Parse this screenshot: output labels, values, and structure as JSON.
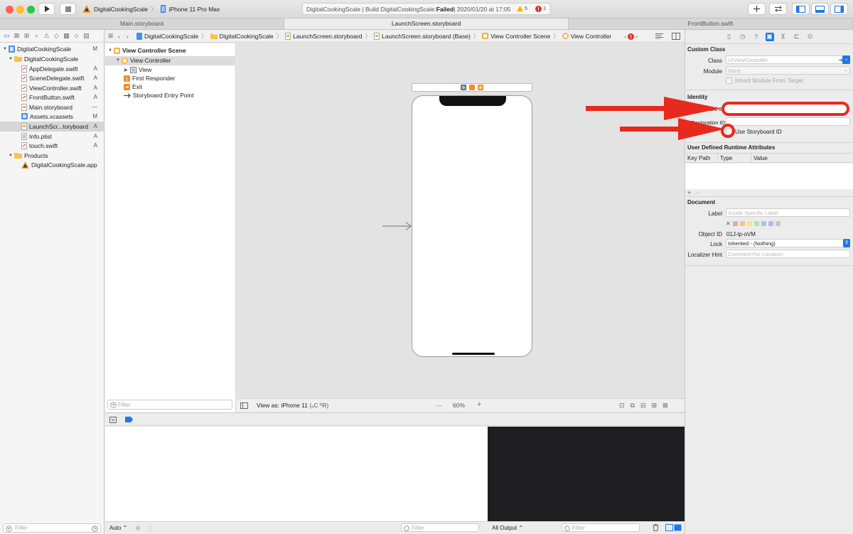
{
  "toolbar": {
    "scheme": "DigitalCookingScale",
    "device": "iPhone 11 Pro Max",
    "activity_prefix": "DigitalCookingScale | Build DigitalCookingScale: ",
    "activity_status": "Failed",
    "activity_time": " | 2020/01/20 at 17:05",
    "warning_count": "5",
    "error_count": "1"
  },
  "tabs": [
    "Main.storyboard",
    "LaunchScreen.storyboard",
    "FrontButton.swift"
  ],
  "navigator": {
    "items": [
      {
        "label": "DigitalCookingScale",
        "badge": "M",
        "kind": "project"
      },
      {
        "label": "DigitalCookingScale",
        "badge": "",
        "kind": "folder"
      },
      {
        "label": "AppDelegate.swift",
        "badge": "A",
        "kind": "swift"
      },
      {
        "label": "SceneDelegate.swift",
        "badge": "A",
        "kind": "swift"
      },
      {
        "label": "ViewController.swift",
        "badge": "A",
        "kind": "swift"
      },
      {
        "label": "FrontButton.swift",
        "badge": "A",
        "kind": "swift"
      },
      {
        "label": "Main.storyboard",
        "badge": "—",
        "kind": "storyboard"
      },
      {
        "label": "Assets.xcassets",
        "badge": "M",
        "kind": "assets"
      },
      {
        "label": "LaunchScr...toryboard",
        "badge": "A",
        "kind": "storyboard"
      },
      {
        "label": "Info.plist",
        "badge": "A",
        "kind": "plist"
      },
      {
        "label": "touch.swift",
        "badge": "A",
        "kind": "swift"
      },
      {
        "label": "Products",
        "badge": "",
        "kind": "folder"
      },
      {
        "label": "DigitalCookingScale.app",
        "badge": "",
        "kind": "app"
      }
    ],
    "filter_placeholder": "Filter"
  },
  "jumpbar": {
    "crumbs": [
      "DigitalCookingScale",
      "DigitalCookingScale",
      "LaunchScreen.storyboard",
      "LaunchScreen.storyboard (Base)",
      "View Controller Scene",
      "View Controller"
    ]
  },
  "outline": {
    "scene": "View Controller Scene",
    "items": [
      "View Controller",
      "View",
      "First Responder",
      "Exit",
      "Storyboard Entry Point"
    ],
    "filter_placeholder": "Filter"
  },
  "canvas": {
    "view_as_prefix": "View as: ",
    "view_as_device": "iPhone 11",
    "view_as_suffix": " (ᵤC ʰR)",
    "zoom": "60%",
    "zoom_out": "—",
    "zoom_in": "+"
  },
  "debug": {
    "auto_label": "Auto ⌃",
    "filter_placeholder": "Filter",
    "output_label": "All Output ⌃"
  },
  "inspector": {
    "custom_class": {
      "title": "Custom Class",
      "class_label": "Class",
      "class_placeholder": "UIViewController",
      "module_label": "Module",
      "module_placeholder": "None",
      "inherit_label": "Inherit Module From Target"
    },
    "identity": {
      "title": "Identity",
      "storyboard_id_label": "Storyboard ID",
      "restoration_id_label": "Restoration ID",
      "use_storyboard_id_label": "Use Storyboard ID"
    },
    "runtime": {
      "title": "User Defined Runtime Attributes",
      "columns": [
        "Key Path",
        "Type",
        "Value"
      ]
    },
    "document": {
      "title": "Document",
      "label_label": "Label",
      "label_placeholder": "Xcode Specific Label",
      "object_id_label": "Object ID",
      "object_id": "01J-lp-oVM",
      "lock_label": "Lock",
      "lock_value": "Inherited - (Nothing)",
      "localizer_label": "Localizer Hint",
      "localizer_placeholder": "Comment For Localizer",
      "swatch_colors": [
        "#f3a3a3",
        "#f6c48b",
        "#f4e58c",
        "#b7e49e",
        "#9ec9f4",
        "#d2a8ec",
        "#c7c7c7"
      ]
    }
  },
  "colors": {
    "accent": "#1e78e6",
    "annotation_red": "#e8291e",
    "error_red": "#e0312a",
    "warning_yellow": "#f4b400"
  }
}
